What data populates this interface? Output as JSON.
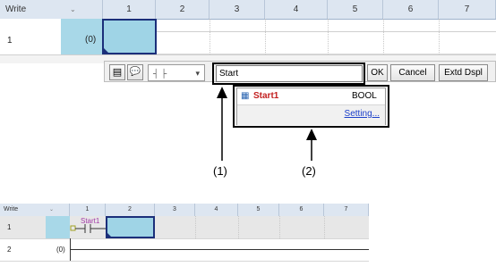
{
  "top_editor": {
    "write_label": "Write",
    "columns": [
      "1",
      "2",
      "3",
      "4",
      "5",
      "6",
      "7"
    ],
    "row_number": "1",
    "step_label": "(0)"
  },
  "input_bar": {
    "contact_symbol": "┤ ├",
    "field_value": "Start",
    "ok_label": "OK",
    "cancel_label": "Cancel",
    "extd_label": "Extd Dspl"
  },
  "suggestion": {
    "name": "Start1",
    "type": "BOOL",
    "setting_link": "Setting..."
  },
  "callouts": {
    "one": "(1)",
    "two": "(2)"
  },
  "bottom_editor": {
    "write_label": "Write",
    "columns": [
      "1",
      "2",
      "3",
      "4",
      "5",
      "6",
      "7"
    ],
    "rows": [
      {
        "number": "1",
        "step": ""
      },
      {
        "number": "2",
        "step": "(0)"
      }
    ],
    "contact_label": "Start1"
  },
  "colors": {
    "header_bg": "#dde6f1",
    "selection": "#9fd4e6",
    "selection_border": "#1b2f7a",
    "contact_label": "#a23aa8",
    "link": "#1a3ec9"
  }
}
